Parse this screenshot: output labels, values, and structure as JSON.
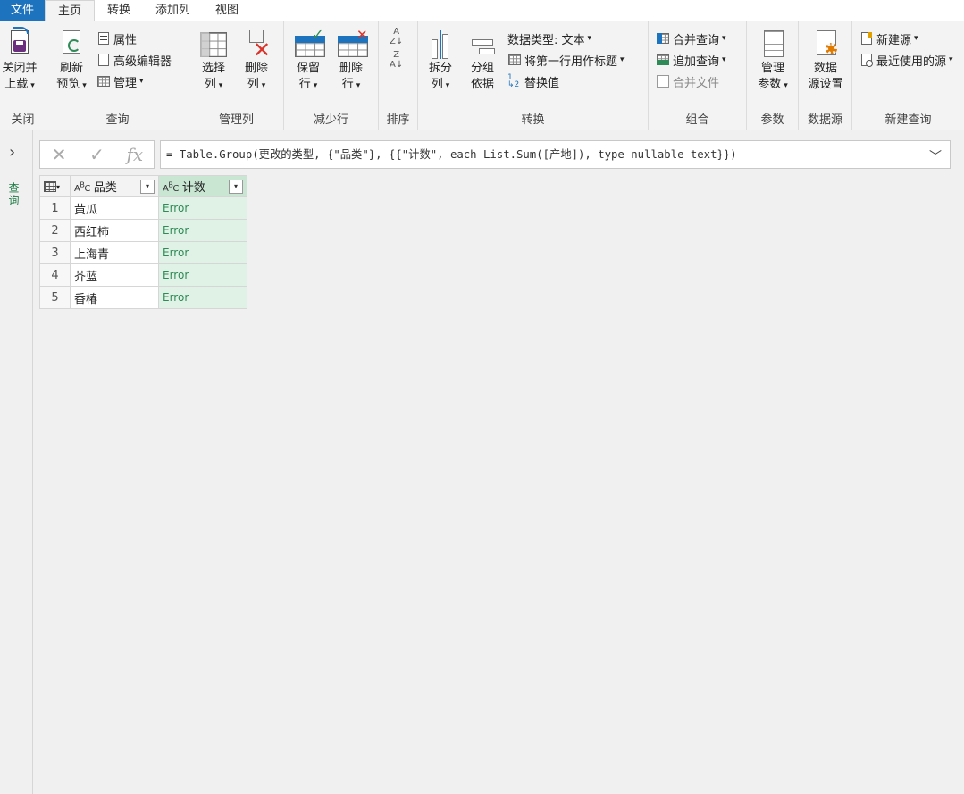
{
  "tabs": [
    {
      "label": "文件"
    },
    {
      "label": "主页"
    },
    {
      "label": "转换"
    },
    {
      "label": "添加列"
    },
    {
      "label": "视图"
    }
  ],
  "ribbon": {
    "close": {
      "btn1": "关闭并",
      "btn2": "上载",
      "group": "关闭"
    },
    "query": {
      "refresh1": "刷新",
      "refresh2": "预览",
      "properties": "属性",
      "advanced_editor": "高级编辑器",
      "manage": "管理",
      "group": "查询"
    },
    "manage_cols": {
      "choose1": "选择",
      "choose2": "列",
      "remove1": "删除",
      "remove2": "列",
      "group": "管理列"
    },
    "reduce_rows": {
      "keep1": "保留",
      "keep2": "行",
      "remove1": "删除",
      "remove2": "行",
      "group": "减少行"
    },
    "sort": {
      "group": "排序"
    },
    "transform": {
      "split1": "拆分",
      "split2": "列",
      "groupby1": "分组",
      "groupby2": "依据",
      "data_type": "数据类型: 文本",
      "first_row_header": "将第一行用作标题",
      "replace_values": "替换值",
      "group": "转换"
    },
    "combine": {
      "merge": "合并查询",
      "append": "追加查询",
      "combine_files": "合并文件",
      "group": "组合"
    },
    "params": {
      "manage1": "管理",
      "manage2": "参数",
      "group": "参数"
    },
    "datasource": {
      "settings1": "数据",
      "settings2": "源设置",
      "group": "数据源"
    },
    "newquery": {
      "new_source": "新建源",
      "recent_sources": "最近使用的源",
      "group": "新建查询"
    }
  },
  "leftnav": {
    "label": "查询"
  },
  "formula": {
    "text": "= Table.Group(更改的类型, {\"品类\"}, {{\"计数\", each List.Sum([产地]), type nullable text}})"
  },
  "table": {
    "columns": [
      "品类",
      "计数"
    ],
    "rows": [
      {
        "n": "1",
        "category": "黄瓜",
        "count": "Error"
      },
      {
        "n": "2",
        "category": "西红柿",
        "count": "Error"
      },
      {
        "n": "3",
        "category": "上海青",
        "count": "Error"
      },
      {
        "n": "4",
        "category": "芥蓝",
        "count": "Error"
      },
      {
        "n": "5",
        "category": "香椿",
        "count": "Error"
      }
    ]
  },
  "colors": {
    "file_tab": "#1e73be",
    "selected_col": "#dff2e5",
    "error_text": "#2e8b57",
    "nav_label": "#1f7a46"
  }
}
